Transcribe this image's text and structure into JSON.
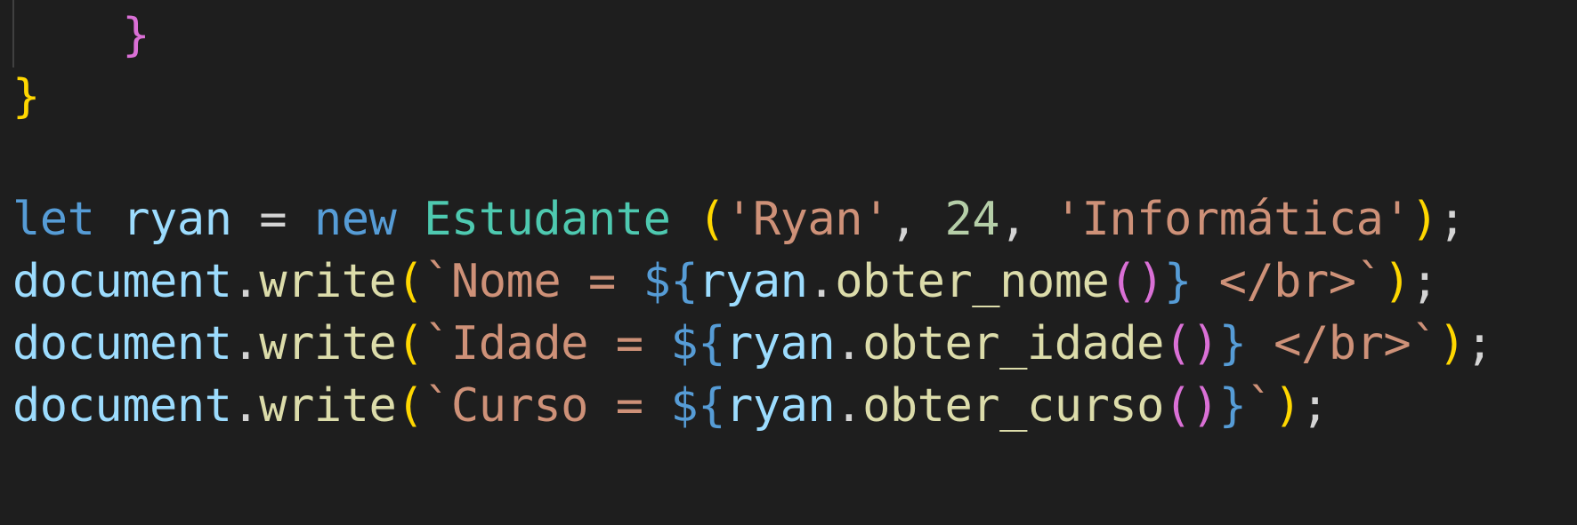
{
  "editor": {
    "lines": [
      {
        "indent": "    ",
        "tokens": [
          {
            "t": "}",
            "c": "br-pink"
          }
        ]
      },
      {
        "indent": "",
        "tokens": [
          {
            "t": "}",
            "c": "br-gold"
          }
        ]
      },
      {
        "indent": "",
        "tokens": []
      },
      {
        "indent": "",
        "tokens": [
          {
            "t": "let",
            "c": "tok-keyword"
          },
          {
            "t": " ",
            "c": "tok-plain"
          },
          {
            "t": "ryan",
            "c": "tok-var"
          },
          {
            "t": " = ",
            "c": "tok-op"
          },
          {
            "t": "new",
            "c": "tok-keyword"
          },
          {
            "t": " ",
            "c": "tok-plain"
          },
          {
            "t": "Estudante",
            "c": "tok-class"
          },
          {
            "t": " ",
            "c": "tok-plain"
          },
          {
            "t": "(",
            "c": "br-gold"
          },
          {
            "t": "'Ryan'",
            "c": "tok-string"
          },
          {
            "t": ", ",
            "c": "tok-plain"
          },
          {
            "t": "24",
            "c": "tok-number"
          },
          {
            "t": ", ",
            "c": "tok-plain"
          },
          {
            "t": "'Informática'",
            "c": "tok-string"
          },
          {
            "t": ")",
            "c": "br-gold"
          },
          {
            "t": ";",
            "c": "tok-plain"
          }
        ]
      },
      {
        "indent": "",
        "tokens": [
          {
            "t": "document",
            "c": "tok-var"
          },
          {
            "t": ".",
            "c": "tok-plain"
          },
          {
            "t": "write",
            "c": "tok-func"
          },
          {
            "t": "(",
            "c": "br-gold"
          },
          {
            "t": "`Nome = ",
            "c": "tok-string"
          },
          {
            "t": "${",
            "c": "tok-interp"
          },
          {
            "t": "ryan",
            "c": "tok-var"
          },
          {
            "t": ".",
            "c": "tok-plain"
          },
          {
            "t": "obter_nome",
            "c": "tok-func"
          },
          {
            "t": "()",
            "c": "br-pink"
          },
          {
            "t": "}",
            "c": "tok-interp"
          },
          {
            "t": " </br>`",
            "c": "tok-string"
          },
          {
            "t": ")",
            "c": "br-gold"
          },
          {
            "t": ";",
            "c": "tok-plain"
          }
        ]
      },
      {
        "indent": "",
        "tokens": [
          {
            "t": "document",
            "c": "tok-var"
          },
          {
            "t": ".",
            "c": "tok-plain"
          },
          {
            "t": "write",
            "c": "tok-func"
          },
          {
            "t": "(",
            "c": "br-gold"
          },
          {
            "t": "`Idade = ",
            "c": "tok-string"
          },
          {
            "t": "${",
            "c": "tok-interp"
          },
          {
            "t": "ryan",
            "c": "tok-var"
          },
          {
            "t": ".",
            "c": "tok-plain"
          },
          {
            "t": "obter_idade",
            "c": "tok-func"
          },
          {
            "t": "()",
            "c": "br-pink"
          },
          {
            "t": "}",
            "c": "tok-interp"
          },
          {
            "t": " </br>`",
            "c": "tok-string"
          },
          {
            "t": ")",
            "c": "br-gold"
          },
          {
            "t": ";",
            "c": "tok-plain"
          }
        ]
      },
      {
        "indent": "",
        "tokens": [
          {
            "t": "document",
            "c": "tok-var"
          },
          {
            "t": ".",
            "c": "tok-plain"
          },
          {
            "t": "write",
            "c": "tok-func"
          },
          {
            "t": "(",
            "c": "br-gold"
          },
          {
            "t": "`Curso = ",
            "c": "tok-string"
          },
          {
            "t": "${",
            "c": "tok-interp"
          },
          {
            "t": "ryan",
            "c": "tok-var"
          },
          {
            "t": ".",
            "c": "tok-plain"
          },
          {
            "t": "obter_curso",
            "c": "tok-func"
          },
          {
            "t": "()",
            "c": "br-pink"
          },
          {
            "t": "}",
            "c": "tok-interp"
          },
          {
            "t": "`",
            "c": "tok-string"
          },
          {
            "t": ")",
            "c": "br-gold"
          },
          {
            "t": ";",
            "c": "tok-plain"
          }
        ]
      }
    ]
  },
  "colors": {
    "background": "#1e1e1e",
    "keyword": "#569cd6",
    "variable": "#9cdcfe",
    "class": "#4ec9b0",
    "string": "#ce9178",
    "number": "#b5cea8",
    "function": "#dcdcaa",
    "bracket_level_1": "#ffd700",
    "bracket_level_2": "#da70d6",
    "bracket_level_3": "#179fff"
  }
}
